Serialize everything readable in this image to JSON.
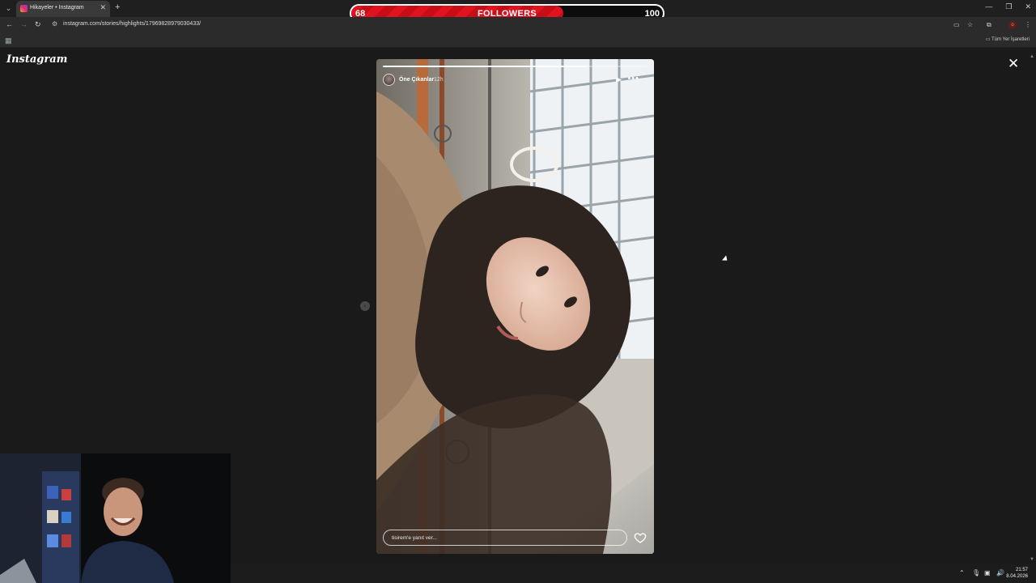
{
  "browser": {
    "tab_title": "Hikayeler • Instagram",
    "tab_close": "✕",
    "new_tab": "+",
    "url": "instagram.com/stories/highlights/17969828979030433/",
    "bookmarks_label": "Tüm Yer İşaretleri",
    "window_minimize": "—",
    "window_restore": "❐",
    "window_close": "✕"
  },
  "overlay": {
    "followers_current": "68",
    "followers_label": "FOLLOWERS",
    "followers_goal": "100",
    "followers_progress": 0.68,
    "bar_color": "#e0131f"
  },
  "instagram": {
    "logo": "Instagram",
    "close_label": "✕"
  },
  "story": {
    "username": "Öne Çıkanlar",
    "time": "12h",
    "progress": 0.77,
    "reply_placeholder": "tisirem'e yanıt ver...",
    "more_label": "•••",
    "play_label": "▶"
  },
  "taskbar": {
    "time": "21:57",
    "date": "8.04.2026"
  }
}
